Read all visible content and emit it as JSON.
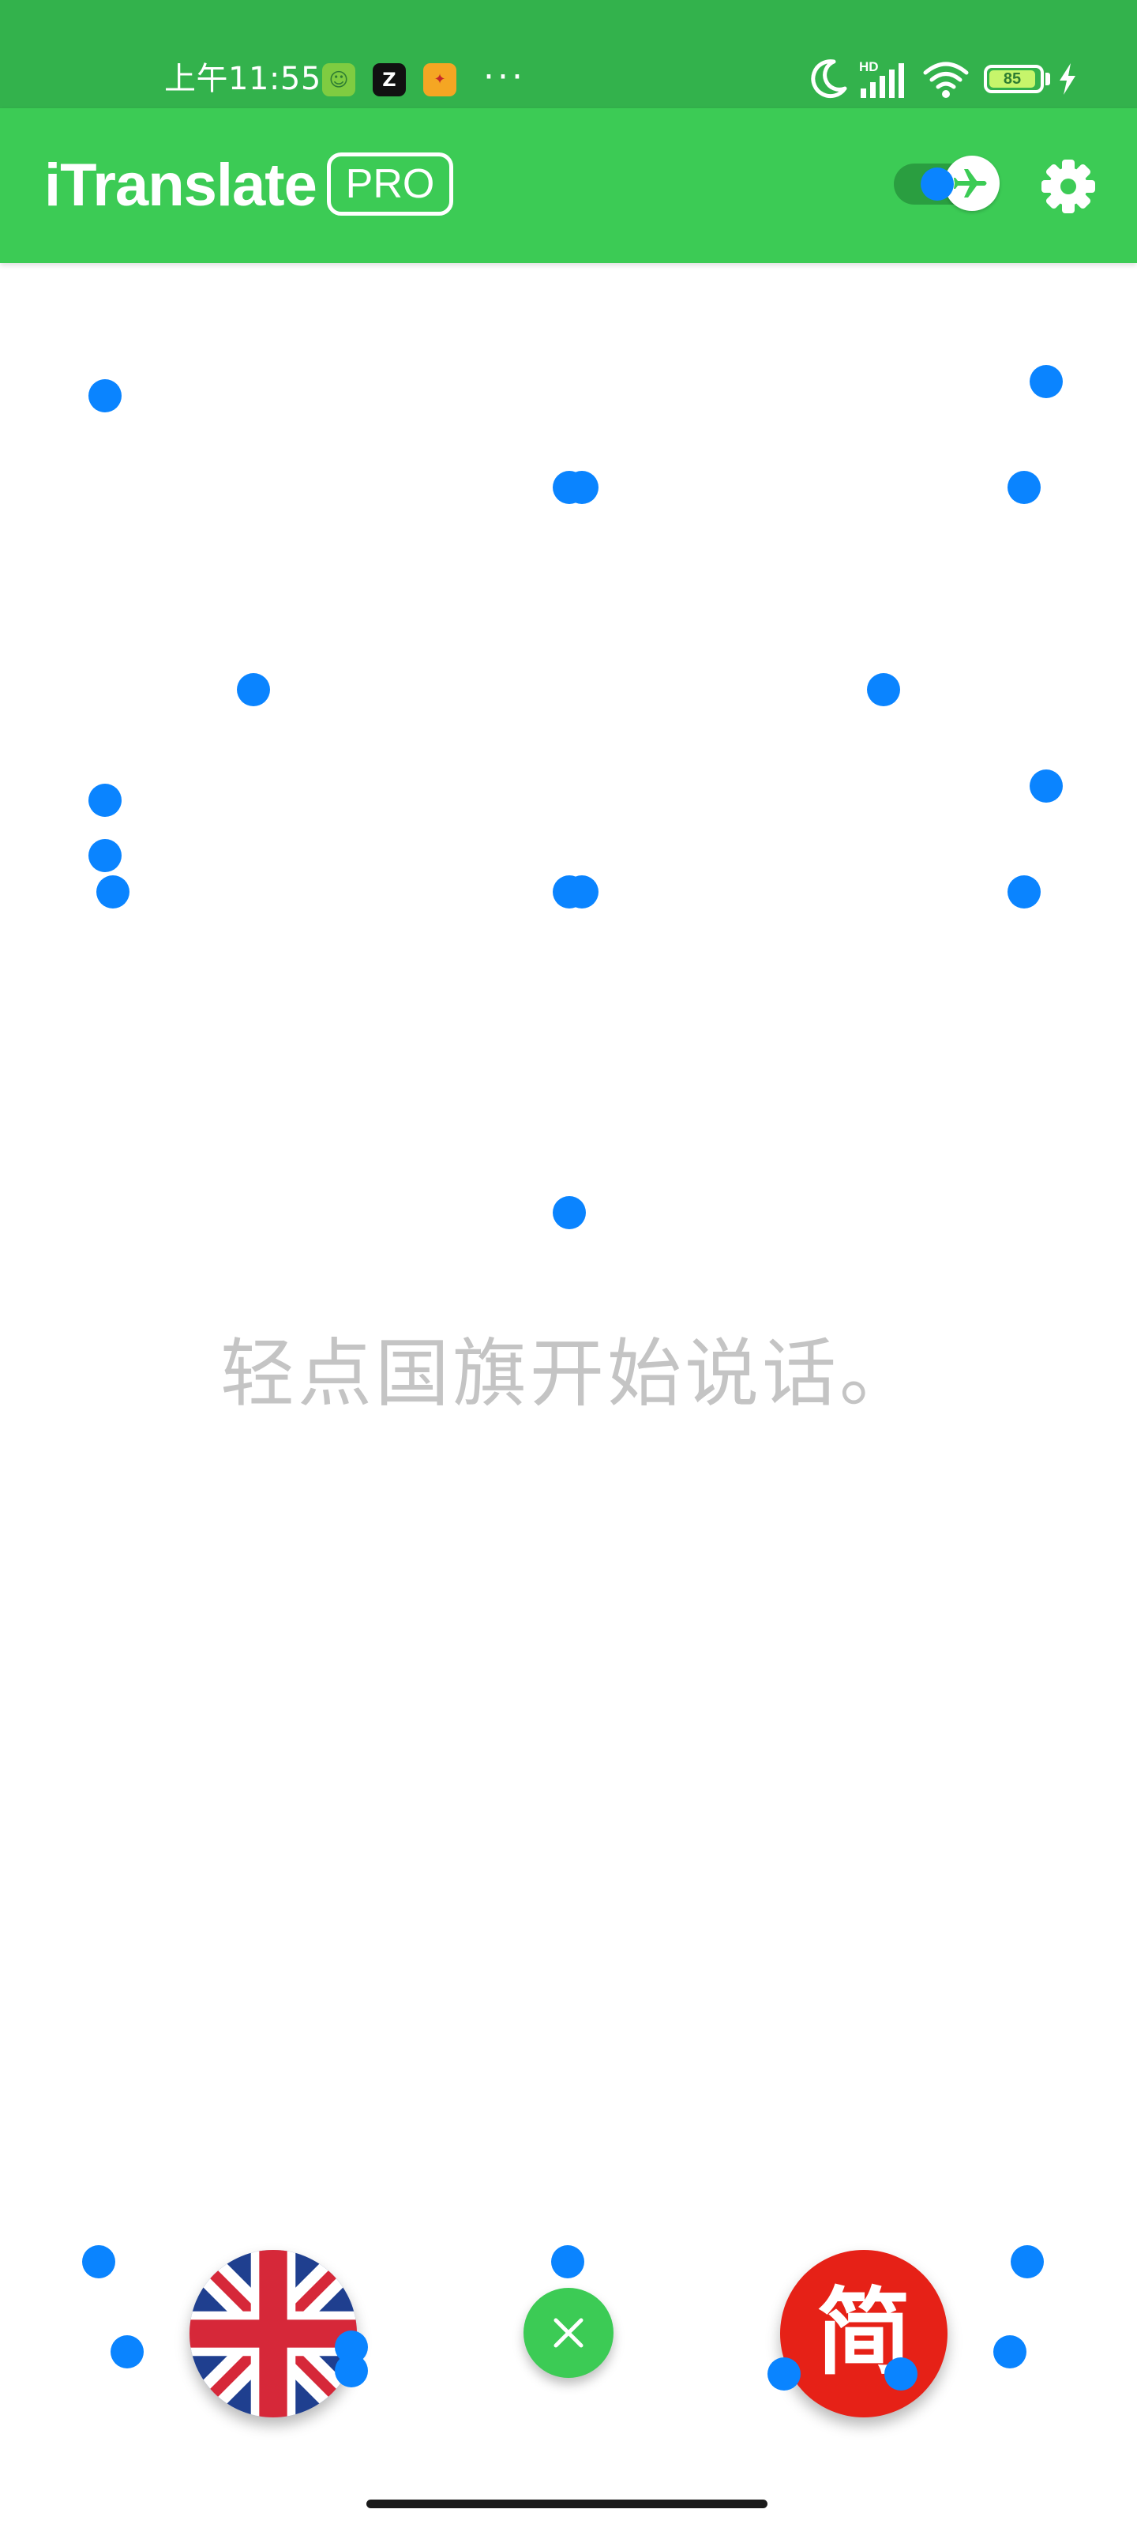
{
  "status_bar": {
    "time": "上午11:55",
    "notifications": [
      {
        "icon": "android-face-icon",
        "glyph": "☺"
      },
      {
        "icon": "z-app-icon",
        "glyph": "Z"
      },
      {
        "icon": "game-app-icon",
        "glyph": "✦"
      }
    ],
    "more": "···",
    "network_label": "HD",
    "battery_level": "85",
    "icons": [
      "moon-icon",
      "signal-icon",
      "wifi-icon",
      "battery-icon",
      "charging-icon"
    ]
  },
  "app_bar": {
    "title": "iTranslate",
    "badge": "PRO",
    "offline_toggle_on": true,
    "icons": [
      "airplane-icon",
      "gear-icon"
    ]
  },
  "main": {
    "hint": "轻点国旗开始说话。"
  },
  "controls": {
    "source_language_flag": "uk-flag",
    "target_language_label": "简",
    "icons": [
      "close-icon"
    ]
  },
  "colors": {
    "status_bar": "#33b24c",
    "app_bar": "#3ccb55",
    "hint_text": "#c4c4c4",
    "target_button": "#e62117",
    "touch_marker": "#0a84ff"
  }
}
